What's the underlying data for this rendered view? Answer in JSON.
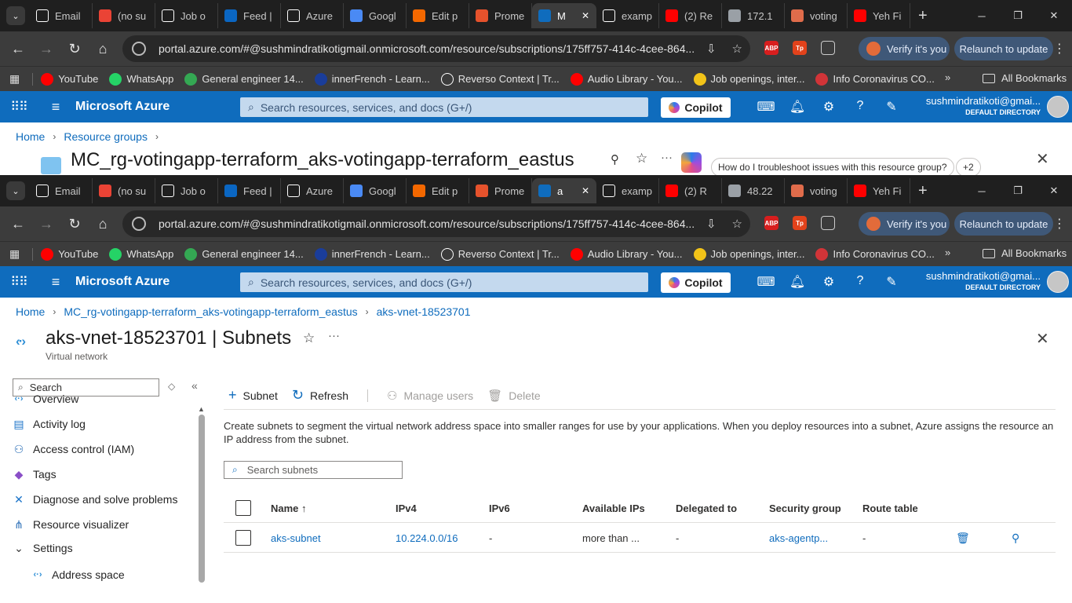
{
  "browser": {
    "tabs_top": [
      {
        "label": "Email",
        "icon": "github-icon",
        "color": "#ffffff"
      },
      {
        "label": "(no su",
        "icon": "gmail-icon",
        "color": "#ea4335"
      },
      {
        "label": "Job o",
        "icon": "openai-icon",
        "color": "#ffffff"
      },
      {
        "label": "Feed |",
        "icon": "linkedin-icon",
        "color": "#0a66c2"
      },
      {
        "label": "Azure",
        "icon": "github-icon",
        "color": "#ffffff"
      },
      {
        "label": "Googl",
        "icon": "gemini-icon",
        "color": "#4a8af4"
      },
      {
        "label": "Edit p",
        "icon": "grafana-icon",
        "color": "#f46800"
      },
      {
        "label": "Prome",
        "icon": "prometheus-icon",
        "color": "#e6522c"
      },
      {
        "label": "M",
        "icon": "azure-icon",
        "color": "#0f6cbd",
        "active": true
      },
      {
        "label": "examp",
        "icon": "github-icon",
        "color": "#ffffff"
      },
      {
        "label": "(2) Re",
        "icon": "youtube-icon",
        "color": "#ff0000"
      },
      {
        "label": "172.1",
        "icon": "globe-icon",
        "color": "#9aa0a6"
      },
      {
        "label": "voting",
        "icon": "vote-icon",
        "color": "#e06c4b"
      },
      {
        "label": "Yeh Fi",
        "icon": "youtube-icon",
        "color": "#ff0000"
      }
    ],
    "tabs_bottom": [
      {
        "label": "Email",
        "icon": "github-icon",
        "color": "#ffffff"
      },
      {
        "label": "(no su",
        "icon": "gmail-icon",
        "color": "#ea4335"
      },
      {
        "label": "Job o",
        "icon": "openai-icon",
        "color": "#ffffff"
      },
      {
        "label": "Feed |",
        "icon": "linkedin-icon",
        "color": "#0a66c2"
      },
      {
        "label": "Azure",
        "icon": "github-icon",
        "color": "#ffffff"
      },
      {
        "label": "Googl",
        "icon": "gemini-icon",
        "color": "#4a8af4"
      },
      {
        "label": "Edit p",
        "icon": "grafana-icon",
        "color": "#f46800"
      },
      {
        "label": "Prome",
        "icon": "prometheus-icon",
        "color": "#e6522c"
      },
      {
        "label": "a",
        "icon": "azure-icon",
        "color": "#0f6cbd",
        "active": true
      },
      {
        "label": "examp",
        "icon": "github-icon",
        "color": "#ffffff"
      },
      {
        "label": "(2) R",
        "icon": "youtube-icon",
        "color": "#ff0000"
      },
      {
        "label": "48.22",
        "icon": "globe-icon",
        "color": "#9aa0a6"
      },
      {
        "label": "voting",
        "icon": "vote-icon",
        "color": "#e06c4b"
      },
      {
        "label": "Yeh Fi",
        "icon": "youtube-icon",
        "color": "#ff0000"
      }
    ],
    "url": "portal.azure.com/#@sushmindratikotigmail.onmicrosoft.com/resource/subscriptions/175ff757-414c-4cee-864...",
    "verify_label": "Verify it's you",
    "relaunch_label": "Relaunch to update",
    "ext_abp": "ABP",
    "ext_tp": "Tp",
    "bookmarks": [
      {
        "label": "YouTube",
        "icon": "youtube-icon",
        "color": "#ff0000"
      },
      {
        "label": "WhatsApp",
        "icon": "whatsapp-icon",
        "color": "#25d366"
      },
      {
        "label": "General engineer 14...",
        "icon": "check-icon",
        "color": "#34a853"
      },
      {
        "label": "innerFrench - Learn...",
        "icon": "innerfrench-icon",
        "color": "#1a3d9a"
      },
      {
        "label": "Reverso Context | Tr...",
        "icon": "reverso-icon",
        "color": "#ffffff"
      },
      {
        "label": "Audio Library - You...",
        "icon": "youtube-icon",
        "color": "#ff0000"
      },
      {
        "label": "Job openings, inter...",
        "icon": "jobs-icon",
        "color": "#f2c318"
      },
      {
        "label": "Info Coronavirus CO...",
        "icon": "info-icon",
        "color": "#d13438"
      }
    ],
    "all_bookmarks": "All Bookmarks"
  },
  "azure": {
    "brand": "Microsoft Azure",
    "search_placeholder": "Search resources, services, and docs (G+/)",
    "copilot": "Copilot",
    "account_top": "sushmindratikoti@gmai...",
    "account_bottom": "sushmindratikoti@gmai...",
    "directory": "DEFAULT DIRECTORY"
  },
  "top_page": {
    "breadcrumb": [
      "Home",
      "Resource groups"
    ],
    "title": "MC_rg-votingapp-terraform_aks-votingapp-terraform_eastus",
    "suggestion": "How do I troubleshoot issues with this resource group?",
    "more_count": "+2"
  },
  "page": {
    "breadcrumb": [
      "Home",
      "MC_rg-votingapp-terraform_aks-votingapp-terraform_eastus",
      "aks-vnet-18523701"
    ],
    "title": "aks-vnet-18523701 | Subnets",
    "subtitle": "Virtual network",
    "left_search": "Search",
    "nav": [
      {
        "label": "Overview",
        "icon": "vnet-icon"
      },
      {
        "label": "Activity log",
        "icon": "activity-log-icon"
      },
      {
        "label": "Access control (IAM)",
        "icon": "iam-icon"
      },
      {
        "label": "Tags",
        "icon": "tag-icon"
      },
      {
        "label": "Diagnose and solve problems",
        "icon": "wrench-icon"
      },
      {
        "label": "Resource visualizer",
        "icon": "visualizer-icon"
      },
      {
        "label": "Settings",
        "icon": "chevron-down-icon"
      },
      {
        "label": "Address space",
        "icon": "vnet-icon"
      }
    ],
    "toolbar": {
      "subnet": "Subnet",
      "refresh": "Refresh",
      "manage_users": "Manage users",
      "delete": "Delete"
    },
    "description": "Create subnets to segment the virtual network address space into smaller ranges for use by your applications. When you deploy resources into a subnet, Azure assigns the resource an IP address from the subnet.",
    "subnet_search_placeholder": "Search subnets",
    "columns": [
      "Name ↑",
      "IPv4",
      "IPv6",
      "Available IPs",
      "Delegated to",
      "Security group",
      "Route table"
    ],
    "rows": [
      {
        "name": "aks-subnet",
        "ipv4": "10.224.0.0/16",
        "ipv6": "-",
        "available": "more than ...",
        "delegated": "-",
        "security": "aks-agentp...",
        "route": "-"
      }
    ]
  }
}
